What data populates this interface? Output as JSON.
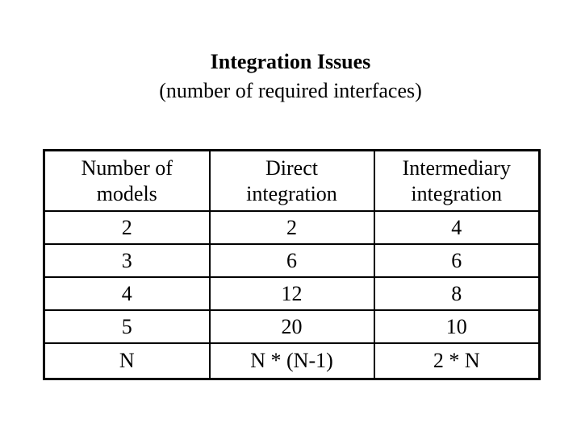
{
  "slide": {
    "title": "Integration Issues",
    "subtitle": "(number of required interfaces)"
  },
  "table": {
    "headers": [
      {
        "line1": "Number of",
        "line2": "models"
      },
      {
        "line1": "Direct",
        "line2": "integration"
      },
      {
        "line1": "Intermediary",
        "line2": "integration"
      }
    ],
    "rows": [
      [
        "2",
        "2",
        "4"
      ],
      [
        "3",
        "6",
        "6"
      ],
      [
        "4",
        "12",
        "8"
      ],
      [
        "5",
        "20",
        "10"
      ],
      [
        "N",
        "N * (N-1)",
        "2 * N"
      ]
    ]
  }
}
